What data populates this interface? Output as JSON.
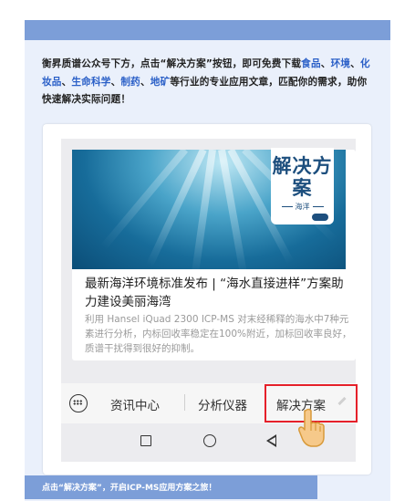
{
  "intro": {
    "part1": "衡昇质谱公众号下方，点击“解决方案”按钮，即可免费下载",
    "hl1": "食品",
    "sep1": "、",
    "hl2": "环境",
    "sep2": "、",
    "hl3": "化妆品",
    "sep3": "、",
    "hl4": "生命科学",
    "sep4": "、",
    "hl5": "制药",
    "sep5": "、",
    "hl6": "地矿",
    "part2": "等行业的专业应用文章，匹配你的需求，助你快速解决实际问题！",
    "highlight_color": "#2a5fc7"
  },
  "article": {
    "badge_big": "解决方案",
    "badge_small": "海洋",
    "title": "最新海洋环境标准发布 | “海水直接进样”方案助力建设美丽海湾",
    "desc": "利用 Hansel iQuad 2300 ICP-MS 对末经稀释的海水中7种元素进行分析，内标回收率稳定在100%附近，加标回收率良好，质谱干扰得到很好的抑制。"
  },
  "menu": {
    "items": [
      "资讯中心",
      "分析仪器",
      "解决方案"
    ],
    "highlight_color": "#e5202a"
  },
  "icons": {
    "keyboard": "keyboard-icon",
    "pencil": "pencil-icon",
    "nav_home": "circle-icon",
    "nav_recent": "square-icon",
    "nav_back": "triangle-back-icon",
    "hand": "pointing-hand-icon"
  },
  "footer": {
    "text": "点击“解决方案”，开启ICP-MS应用方案之旅！"
  },
  "colors": {
    "accent_bar": "#7c9ed8",
    "card_bg": "#eaf0fb"
  }
}
